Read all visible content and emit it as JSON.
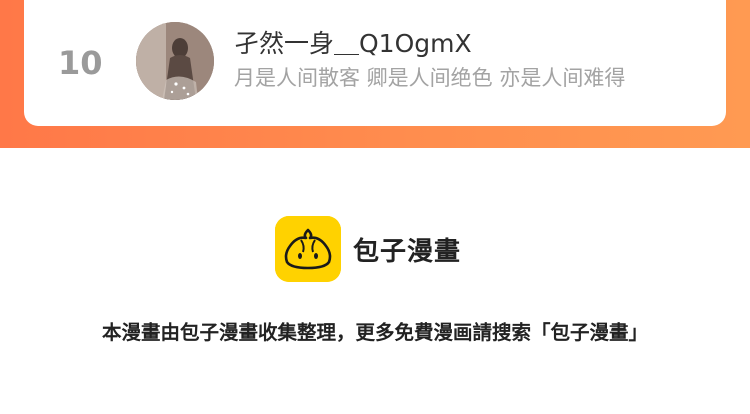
{
  "ranking_entry": {
    "rank": "10",
    "user_name": "孑然一身＿Q1OgmX",
    "motto": "月是人间散客 卿是人间绝色 亦是人间难得"
  },
  "footer": {
    "brand_name": "包子漫畫",
    "notice": "本漫畫由包子漫畫收集整理，更多免費漫画請搜索「包子漫畫」"
  },
  "colors": {
    "band_gradient_start": "#ff7848",
    "band_gradient_end": "#ff9a52",
    "logo_yellow": "#ffd200"
  },
  "icons": {
    "avatar": "avatar-photo",
    "logo": "bun-mascot-icon"
  }
}
